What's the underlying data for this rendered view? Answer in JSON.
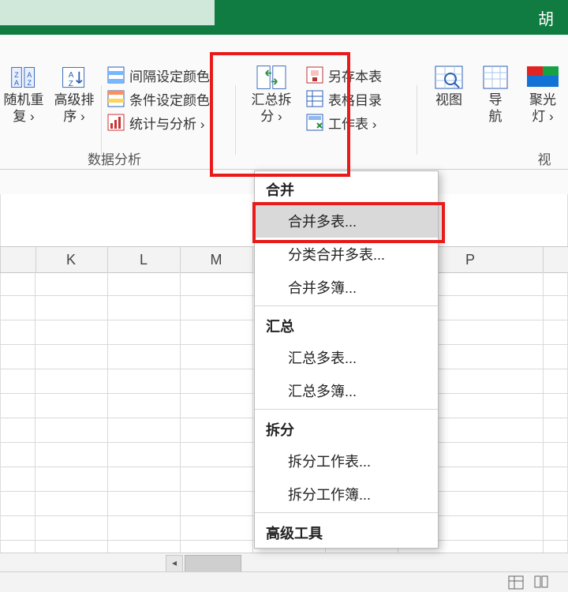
{
  "titlebar": {
    "right_text": "胡"
  },
  "ribbon": {
    "group_labels": {
      "data_analysis": "数据分析",
      "view_group": "视"
    },
    "buttons": {
      "random_reorder": {
        "line1": "随机重",
        "line2": "复 ›"
      },
      "advanced_sort": {
        "line1": "高级排",
        "line2": "序 ›"
      },
      "interval_color": "间隔设定颜色",
      "conditional_color": "条件设定颜色",
      "stats_analysis": "统计与分析 ›",
      "summary_split": {
        "line1": "汇总拆",
        "line2": "分 ›"
      },
      "save_sheet": "另存本表",
      "sheet_catalog": "表格目录",
      "worksheet": "工作表 ›",
      "view": "视图",
      "navigate": {
        "line1": "导",
        "line2": "航"
      },
      "spotlight": {
        "line1": "聚光",
        "line2": "灯 ›"
      }
    }
  },
  "columns": [
    "K",
    "L",
    "M",
    "",
    "",
    "P",
    ""
  ],
  "menu": {
    "sections": [
      {
        "head": "合并",
        "items": [
          "合并多表...",
          "分类合并多表...",
          "合并多簿..."
        ]
      },
      {
        "head": "汇总",
        "items": [
          "汇总多表...",
          "汇总多簿..."
        ]
      },
      {
        "head": "拆分",
        "items": [
          "拆分工作表...",
          "拆分工作簿..."
        ]
      },
      {
        "head": "高级工具",
        "items": []
      }
    ],
    "highlight_index": [
      0,
      0
    ]
  }
}
